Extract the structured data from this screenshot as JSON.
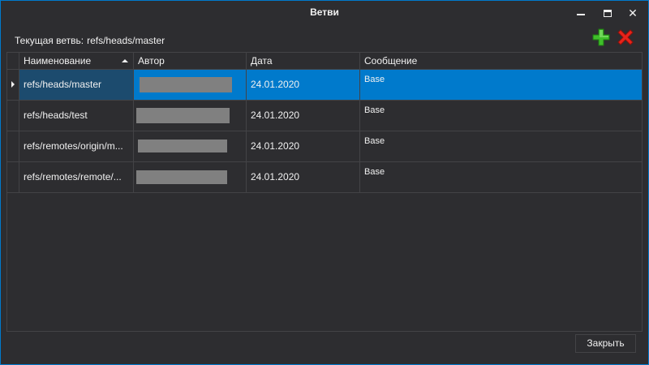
{
  "window": {
    "title": "Ветви"
  },
  "current_branch": {
    "label": "Текущая ветвь:",
    "value": "refs/heads/master"
  },
  "toolbar": {
    "add_icon": "plus-icon",
    "delete_icon": "x-icon",
    "add_color": "#3fbf2a",
    "delete_color": "#e8231a"
  },
  "grid": {
    "columns": [
      "Наименование",
      "Автор",
      "Дата",
      "Сообщение"
    ],
    "sorted_column": "Наименование",
    "sort_direction": "ascending",
    "rows": [
      {
        "name": "refs/heads/master",
        "author": "",
        "date": "24.01.2020",
        "message": "Base",
        "selected": true
      },
      {
        "name": "refs/heads/test",
        "author": "",
        "date": "24.01.2020",
        "message": "Base",
        "selected": false
      },
      {
        "name": "refs/remotes/origin/m...",
        "author": "",
        "date": "24.01.2020",
        "message": "Base",
        "selected": false
      },
      {
        "name": "refs/remotes/remote/...",
        "author": "",
        "date": "24.01.2020",
        "message": "Base",
        "selected": false
      }
    ]
  },
  "footer": {
    "close_label": "Закрыть"
  },
  "colors": {
    "accent": "#007acc",
    "background": "#2d2d30",
    "border": "#434346",
    "redaction": "#808080"
  }
}
